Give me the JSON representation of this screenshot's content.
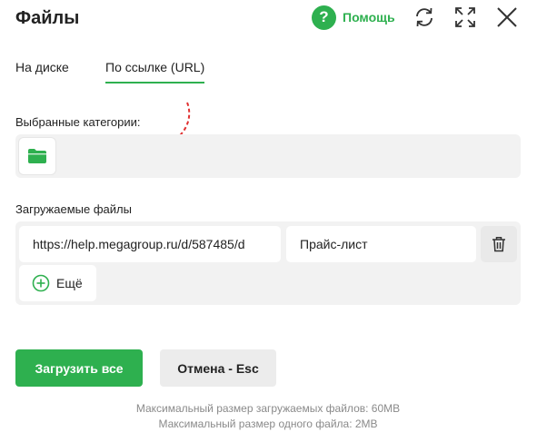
{
  "header": {
    "title": "Файлы",
    "help_label": "Помощь",
    "help_glyph": "?",
    "accent_color": "#2eb04f",
    "icons": [
      "help-icon",
      "refresh-icon",
      "fullscreen-icon",
      "close-icon"
    ]
  },
  "tabs": [
    {
      "label": "На диске",
      "active": false
    },
    {
      "label": "По ссылке (URL)",
      "active": true
    }
  ],
  "categories": {
    "label": "Выбранные категории:",
    "folder_icon": "folder-icon"
  },
  "files": {
    "label": "Загружаемые файлы",
    "rows": [
      {
        "url": "https://help.megagroup.ru/d/587485/d",
        "name": "Прайс-лист"
      }
    ],
    "more_label": "Ещё"
  },
  "actions": {
    "upload_label": "Загрузить все",
    "cancel_label": "Отмена - Esc"
  },
  "limits": {
    "total": "Максимальный размер загружаемых файлов: 60MB",
    "single": "Максимальный размер одного файла: 2MB"
  }
}
